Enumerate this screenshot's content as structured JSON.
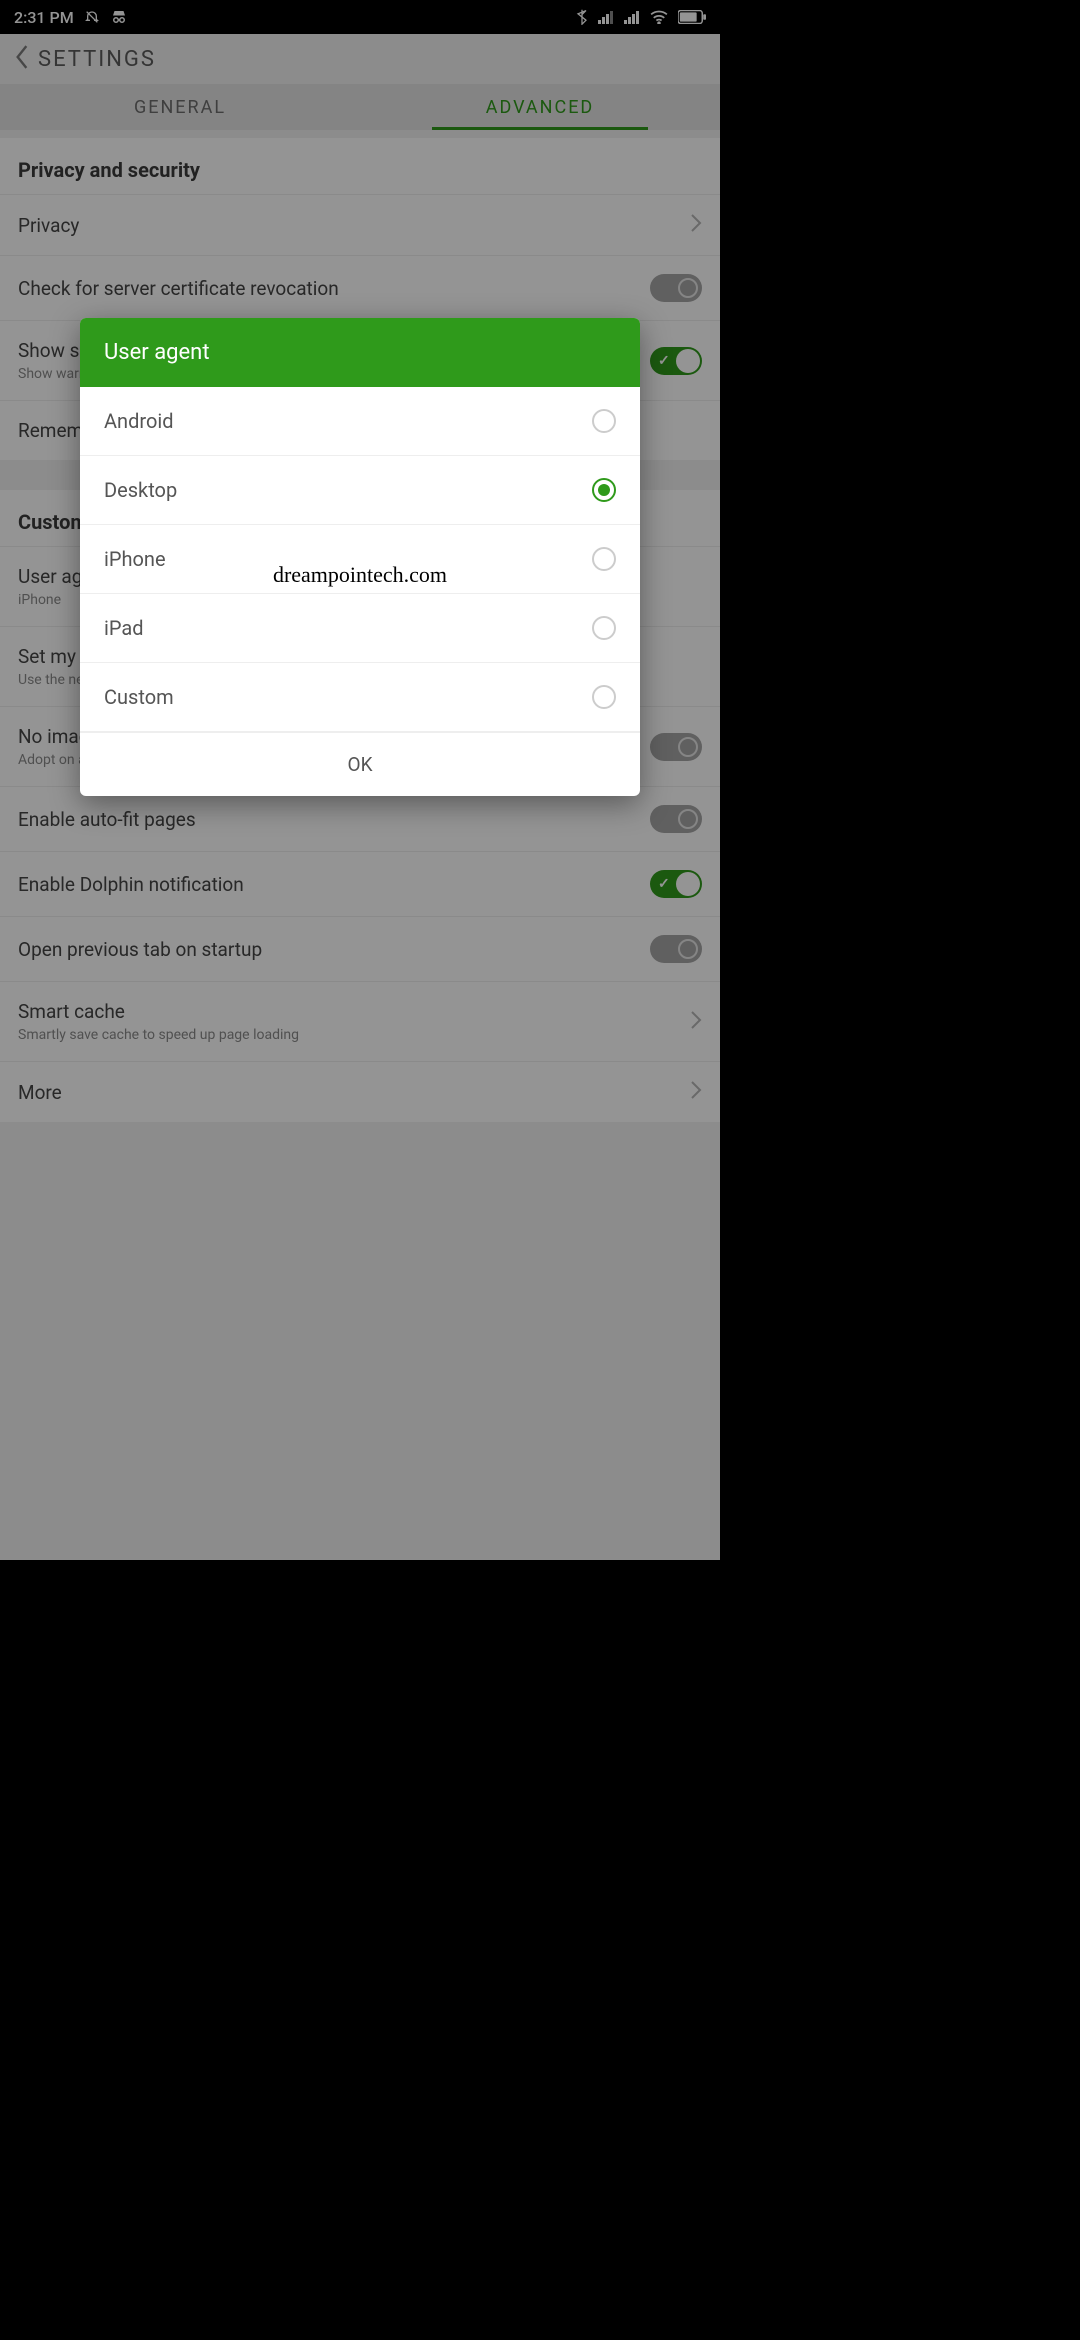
{
  "status": {
    "time": "2:31 PM"
  },
  "header": {
    "title": "SETTINGS"
  },
  "tabs": {
    "general": "GENERAL",
    "advanced": "ADVANCED"
  },
  "sections": {
    "privacy_security": "Privacy and security",
    "customize": "Customize"
  },
  "rows": {
    "privacy": "Privacy",
    "cert_revocation": "Check for server certificate revocation",
    "show_security": {
      "title": "Show security warnings",
      "sub": "Show warning if there is a problem with..."
    },
    "remember_passwords": "Remember passwords",
    "user_agent": {
      "title": "User agent",
      "sub": "iPhone"
    },
    "set_home": {
      "title": "Set my homepage",
      "sub": "Use the new tab page"
    },
    "no_image": {
      "title": "No image mode",
      "sub": "Adopt on all networks"
    },
    "auto_fit": "Enable auto-fit pages",
    "dolphin_notif": "Enable Dolphin notification",
    "open_prev": "Open previous tab on startup",
    "smart_cache": {
      "title": "Smart cache",
      "sub": "Smartly save cache to speed up page loading"
    },
    "more": "More"
  },
  "dialog": {
    "title": "User agent",
    "options": [
      "Android",
      "Desktop",
      "iPhone",
      "iPad",
      "Custom"
    ],
    "selected_index": 1,
    "ok": "OK"
  },
  "watermark": "dreampointech.com"
}
